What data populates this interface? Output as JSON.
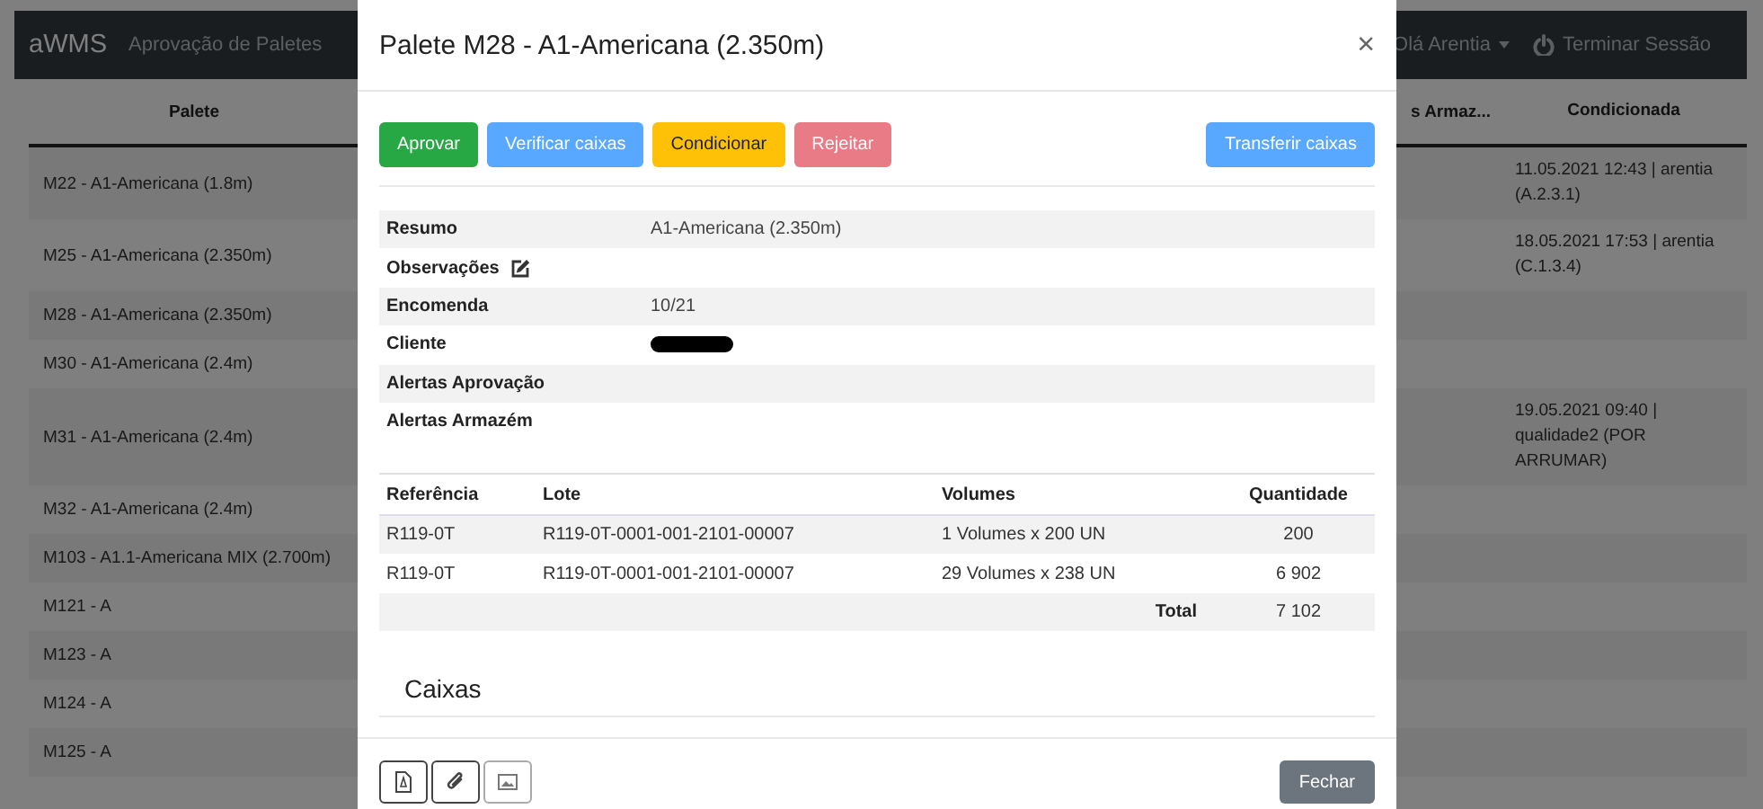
{
  "navbar": {
    "brand": "aWMS",
    "links": [
      "Aprovação de Paletes"
    ],
    "user_menu": "Olá Arentia",
    "logout": "Terminar Sessão"
  },
  "table": {
    "columns": [
      "Palete",
      "s Armaz...",
      "Condicionada"
    ],
    "rows": [
      {
        "palete": "M22 - A1-Americana (1.8m)",
        "condicionada": "11.05.2021 12:43 | arentia (A.2.3.1)"
      },
      {
        "palete": "M25 - A1-Americana (2.350m)",
        "condicionada": "18.05.2021 17:53 | arentia (C.1.3.4)"
      },
      {
        "palete": "M28 - A1-Americana (2.350m)"
      },
      {
        "palete": "M30 - A1-Americana (2.4m)"
      },
      {
        "palete": "M31 - A1-Americana (2.4m)",
        "condicionada": "19.05.2021 09:40 | qualidade2 (POR ARRUMAR)"
      },
      {
        "palete": "M32 - A1-Americana (2.4m)"
      },
      {
        "palete": "M103 - A1.1-Americana MIX (2.700m)"
      },
      {
        "palete": "M121 - A"
      },
      {
        "palete": "M123 - A"
      },
      {
        "palete": "M124 - A"
      },
      {
        "palete": "M125 - A"
      }
    ]
  },
  "modal": {
    "title": "Palete M28 - A1-Americana (2.350m)",
    "close": "×",
    "actions": [
      {
        "label": "Aprovar",
        "kind": "approve",
        "disabled": false
      },
      {
        "label": "Verificar caixas",
        "kind": "verify",
        "disabled": true
      },
      {
        "label": "Condicionar",
        "kind": "condition",
        "disabled": false
      },
      {
        "label": "Rejeitar",
        "kind": "reject",
        "disabled": true
      }
    ],
    "actions_right": [
      {
        "label": "Transferir caixas",
        "kind": "transfer",
        "disabled": true
      }
    ],
    "details": [
      {
        "label": "Resumo",
        "value": "A1-Americana (2.350m)",
        "editable": false,
        "redacted": false
      },
      {
        "label": "Observações",
        "editable": true,
        "redacted": false
      },
      {
        "label": "Encomenda",
        "value": "10/21",
        "editable": false,
        "redacted": false
      },
      {
        "label": "Cliente",
        "editable": false,
        "redacted": true
      },
      {
        "label": "Alertas Aprovação",
        "editable": false,
        "redacted": false
      },
      {
        "label": "Alertas Armazém",
        "editable": false,
        "redacted": false
      }
    ],
    "items": {
      "columns": [
        "Referência",
        "Lote",
        "Volumes",
        "Quantidade"
      ],
      "rows": [
        [
          "R119-0T",
          "R119-0T-0001-001-2101-00007",
          "1 Volumes x 200 UN",
          "200"
        ],
        [
          "R119-0T",
          "R119-0T-0001-001-2101-00007",
          "29 Volumes x 238 UN",
          "6 902"
        ]
      ],
      "total_label": "Total",
      "total": "7 102"
    },
    "section_title": "Caixas",
    "footer_tools": [
      {
        "kind": "pdf",
        "disabled": false
      },
      {
        "kind": "attachment",
        "disabled": false
      },
      {
        "kind": "image",
        "disabled": true
      }
    ],
    "footer_button": "Fechar"
  }
}
